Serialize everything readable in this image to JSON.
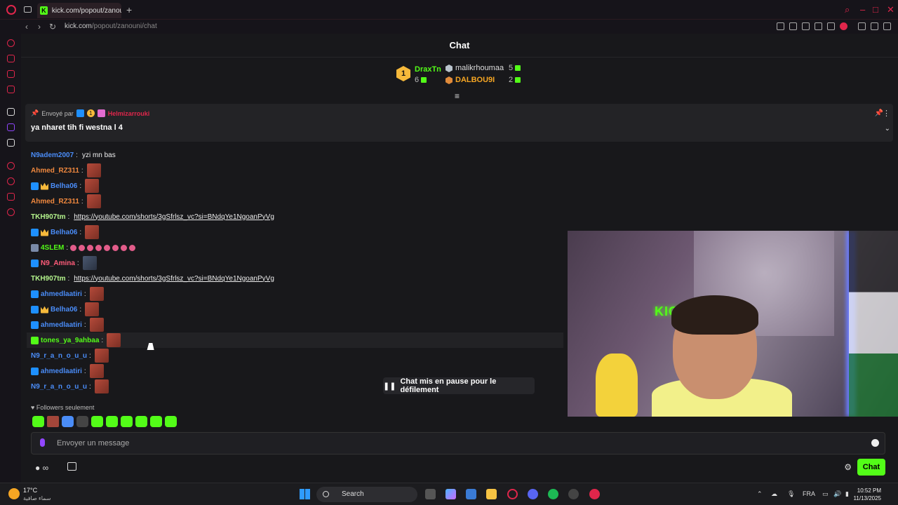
{
  "browser": {
    "tab_title": "kick.com/popout/zanouni",
    "tab_favicon": "K",
    "url_host": "kick.com",
    "url_path": "/popout/zanouni/chat"
  },
  "chat": {
    "header_title": "Chat",
    "leaderboard": {
      "first": {
        "rank": "1",
        "name": "DraxTn",
        "count": "6"
      },
      "second": {
        "name": "malikrhoumaa",
        "count": "5"
      },
      "third": {
        "name": "DALBOU9I",
        "count": "2"
      }
    },
    "pinned": {
      "sent_by_label": "Envoyé par",
      "badge_num": "1",
      "user": "Helmizarrouki",
      "text": "ya nharet tih fi westna l 4"
    },
    "messages": [
      {
        "user": "N9adem2007",
        "color": "#4a8cf7",
        "text": "yzi mn bas"
      },
      {
        "user": "Ahmed_RZ311",
        "color": "#f0883e",
        "text": ""
      },
      {
        "user": "Belha06",
        "color": "#4a8cf7",
        "text": ""
      },
      {
        "user": "Ahmed_RZ311",
        "color": "#f0883e",
        "text": ""
      },
      {
        "user": "TKH907tm",
        "color": "#b5f58d",
        "link": "https://youtube.com/shorts/3gSfrlsz_vc?si=BNdqYe1NgoanPyVg"
      },
      {
        "user": "Belha06",
        "color": "#4a8cf7",
        "text": ""
      },
      {
        "user": "4SLEM",
        "color": "#53fc18",
        "text": ""
      },
      {
        "user": "N9_Amina",
        "color": "#ff5c7a",
        "text": ""
      },
      {
        "user": "TKH907tm",
        "color": "#b5f58d",
        "link": "https://youtube.com/shorts/3gSfrlsz_vc?si=BNdqYe1NgoanPyVg"
      },
      {
        "user": "ahmedlaatiri",
        "color": "#4a8cf7",
        "text": ""
      },
      {
        "user": "Belha06",
        "color": "#4a8cf7",
        "text": ""
      },
      {
        "user": "ahmedlaatiri",
        "color": "#4a8cf7",
        "text": ""
      },
      {
        "user": "tones_ya_9ahbaa",
        "color": "#53fc18",
        "text": ""
      },
      {
        "user": "N9_r_a_n_o_u_u",
        "color": "#4a8cf7",
        "text": ""
      },
      {
        "user": "ahmedlaatiri",
        "color": "#4a8cf7",
        "text": ""
      },
      {
        "user": "N9_r_a_n_o_u_u",
        "color": "#4a8cf7",
        "text": ""
      }
    ],
    "pause_label": "Chat mis en pause pour le défilement",
    "followers_label": "Followers seulement",
    "input_placeholder": "Envoyer un message",
    "send_label": "Chat"
  },
  "webcam": {
    "sign_text": "KICK"
  },
  "taskbar": {
    "temperature": "17°C",
    "weather": "سماء صافية",
    "search_label": "Search",
    "language": "FRA",
    "time": "10:52 PM",
    "date": "11/13/2025"
  }
}
